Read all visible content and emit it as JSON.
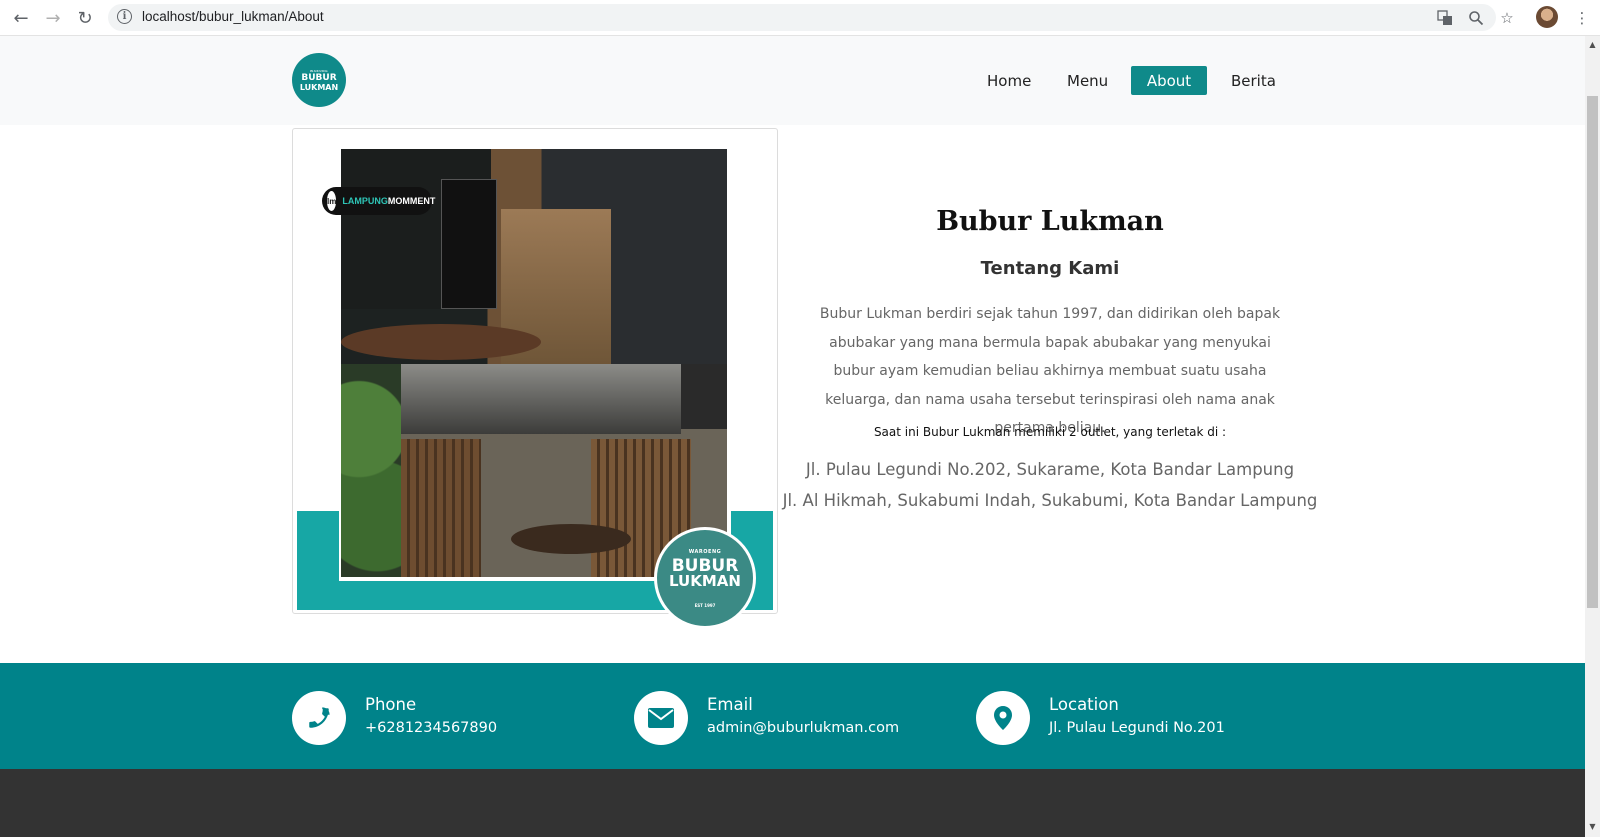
{
  "browser": {
    "url": "localhost/bubur_lukman/About"
  },
  "site": {
    "logo": {
      "small": "WARUNG",
      "line1": "BUBUR",
      "line2": "LUKMAN"
    },
    "nav": [
      {
        "label": "Home",
        "active": false
      },
      {
        "label": "Menu",
        "active": false
      },
      {
        "label": "About",
        "active": true
      },
      {
        "label": "Berita",
        "active": false
      }
    ],
    "accent_color": "#0f8a8a"
  },
  "photo": {
    "watermark_brand_a": "LAMPUNG",
    "watermark_brand_b": "MOMMENT",
    "watermark_circle": "lm",
    "badge_small": "WAROENG",
    "badge_line1": "BUBUR",
    "badge_line2": "LUKMAN",
    "badge_est": "EST 1997"
  },
  "about": {
    "title": "Bubur Lukman",
    "subtitle": "Tentang Kami",
    "description": "Bubur Lukman berdiri sejak tahun 1997, dan didirikan oleh bapak abubakar yang mana bermula bapak abubakar yang menyukai bubur ayam kemudian beliau akhirnya membuat suatu usaha keluarga, dan nama usaha tersebut terinspirasi oleh nama anak pertama beliau.",
    "outlet_intro": "Saat ini Bubur Lukman memiliki 2 outlet, yang terletak di :",
    "outlets": [
      "Jl. Pulau Legundi No.202, Sukarame, Kota Bandar Lampung",
      "Jl. Al Hikmah, Sukabumi Indah, Sukabumi, Kota Bandar Lampung"
    ]
  },
  "contact": {
    "phone": {
      "label": "Phone",
      "value": "+6281234567890",
      "icon": "phone-icon"
    },
    "email": {
      "label": "Email",
      "value": "admin@buburlukman.com",
      "icon": "envelope-icon"
    },
    "location": {
      "label": "Location",
      "value": "Jl. Pulau Legundi No.201",
      "icon": "map-pin-icon"
    }
  }
}
